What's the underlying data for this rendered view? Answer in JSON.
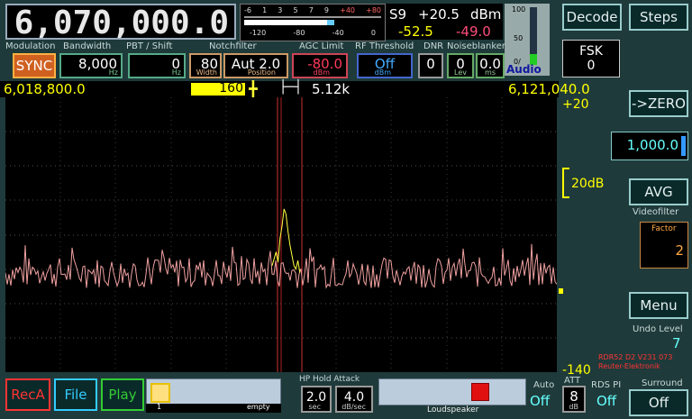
{
  "frequency": "6,070,000.0",
  "smeter": {
    "scale_top": [
      "-6",
      "1",
      "3",
      "5",
      "7",
      "9",
      "+40",
      "+80"
    ],
    "scale_bottom": [
      "-120",
      "-80",
      "-40",
      "0"
    ],
    "s_value": "S9",
    "s_plus": "+20.5",
    "s_unit": "dBm",
    "level_a": "-52.5",
    "level_b": "-49.0"
  },
  "audio": {
    "label": "Audio",
    "ticks": [
      "100",
      "50",
      "0/"
    ]
  },
  "labels": {
    "modulation": "Modulation",
    "bandwidth": "Bandwidth",
    "pbt": "PBT / Shift",
    "notch": "Notchfilter",
    "agc": "AGC Limit",
    "rf_threshold": "RF Threshold",
    "dnr": "DNR",
    "noiseblanker": "Noiseblanker"
  },
  "controls": {
    "modulation": "SYNC",
    "bandwidth": "8,000",
    "bandwidth_unit": "Hz",
    "pbt": "0",
    "pbt_unit": "Hz",
    "notch_width": "80",
    "notch_width_unit": "Width",
    "notch_pos": "Aut 2.0",
    "notch_pos_unit": "Position",
    "agc": "-80.0",
    "agc_unit": "dBm",
    "rf": "Off",
    "rf_unit": "dBm",
    "dnr": "0",
    "nb_lev": "0",
    "nb_lev_unit": "Lev",
    "nb_ms": "0.0",
    "nb_ms_unit": "ms"
  },
  "span": {
    "left_freq": "6,018,800.0",
    "center_value": "160",
    "span_value": "5.12k",
    "right_freq": "6,121,040.0"
  },
  "scale": {
    "top": "+20",
    "db_marker": "20dB",
    "bottom": "-140"
  },
  "right_panel": {
    "decode": "Decode",
    "steps": "Steps",
    "fsk_line1": "FSK",
    "fsk_line2": "0",
    "tozero": "->ZERO",
    "step_value": "1,000.0",
    "avg": "AVG",
    "videofilter": "Videofilter",
    "factor_label": "Factor",
    "factor_value": "2",
    "menu": "Menu",
    "undo_label": "Undo Level",
    "undo_value": "7",
    "version_line1": "RDR52 D2 V231 073",
    "version_line2": "Reuter-Elektronik",
    "surround_label": "Surround",
    "surround_value": "Off"
  },
  "bottom": {
    "rec": "RecA",
    "file": "File",
    "play": "Play",
    "slot_num": "1",
    "slot_empty": "empty",
    "hp_label": "HP Hold Attack",
    "hold": "2.0",
    "hold_unit": "sec",
    "attack": "4.0",
    "attack_unit": "dB/sec",
    "loudspeaker": "Loudspeaker",
    "auto_label": "Auto",
    "auto_value": "Off",
    "att_label": "ATT",
    "att_value": "8",
    "att_unit": "dB",
    "rds_label": "RDS PI",
    "rds_value": "Off"
  },
  "chart_data": {
    "type": "line",
    "x_range": [
      6018800,
      6121040
    ],
    "ylim": [
      -140,
      20
    ],
    "grid": true,
    "series": [
      {
        "color": "#f0a0a0"
      },
      {
        "color": "#ffff40"
      }
    ]
  },
  "colors": {
    "panel_bg": "#1f3a3a",
    "freq_yellow": "#ffff00",
    "accent_red": "#ff3333",
    "marker_yellow": "#ffff33"
  }
}
